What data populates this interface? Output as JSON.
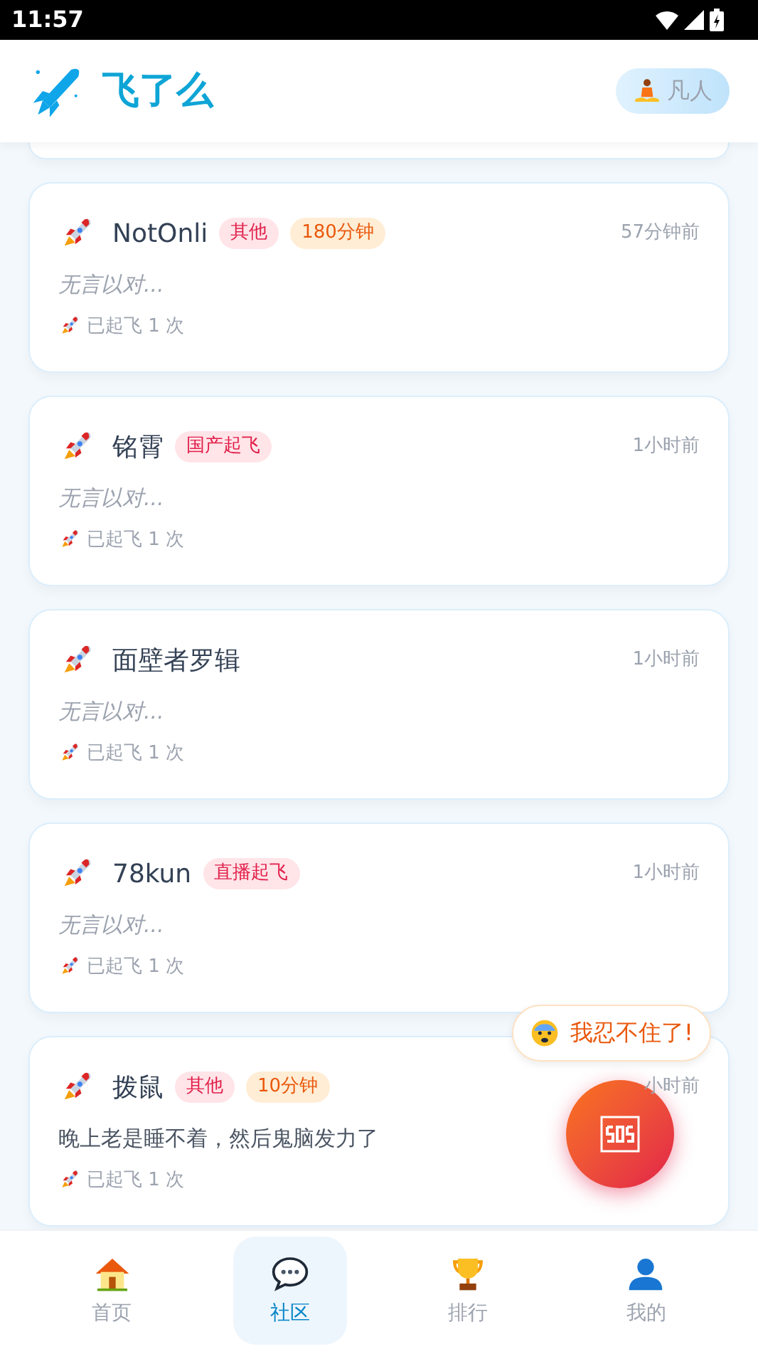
{
  "status_bar": {
    "time": "11:57"
  },
  "header": {
    "title": "飞了么",
    "rank": "凡人"
  },
  "posts": [
    {
      "name": "NotOnli",
      "tags": [
        {
          "kind": "category",
          "text": "其他"
        },
        {
          "kind": "duration",
          "text": "180分钟"
        }
      ],
      "time": "57分钟前",
      "content": "无言以对...",
      "placeholder": true,
      "launches": "已起飞 1 次"
    },
    {
      "name": "铭霄",
      "tags": [
        {
          "kind": "category",
          "text": "国产起飞"
        }
      ],
      "time": "1小时前",
      "content": "无言以对...",
      "placeholder": true,
      "launches": "已起飞 1 次"
    },
    {
      "name": "面壁者罗辑",
      "time": "1小时前",
      "content": "无言以对...",
      "placeholder": true,
      "launches": "已起飞 1 次"
    },
    {
      "name": "78kun",
      "tags": [
        {
          "kind": "category",
          "text": "直播起飞"
        }
      ],
      "time": "1小时前",
      "content": "无言以对...",
      "placeholder": true,
      "launches": "已起飞 1 次"
    },
    {
      "name": "拨鼠",
      "tags": [
        {
          "kind": "category",
          "text": "其他"
        },
        {
          "kind": "duration",
          "text": "10分钟"
        }
      ],
      "time": "小时前",
      "content": "晚上老是睡不着，然后鬼脑发力了",
      "placeholder": false,
      "launches": "已起飞 1 次"
    }
  ],
  "sos": {
    "bubble": "我忍不住了!"
  },
  "nav": [
    {
      "kind": "home",
      "label": "首页",
      "selected": false
    },
    {
      "kind": "community",
      "label": "社区",
      "selected": true
    },
    {
      "kind": "ranking",
      "label": "排行",
      "selected": false
    },
    {
      "kind": "profile",
      "label": "我的",
      "selected": false
    }
  ]
}
